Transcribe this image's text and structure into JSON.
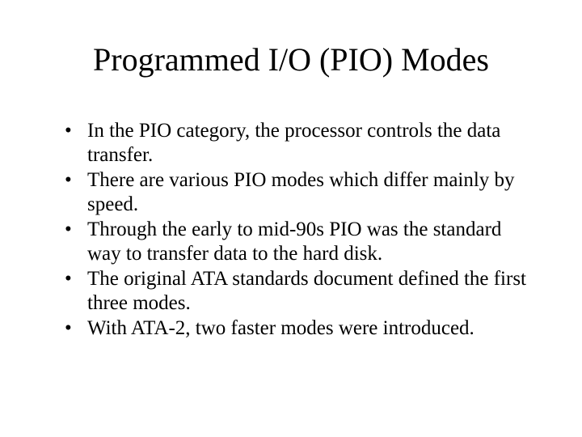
{
  "slide": {
    "title": "Programmed I/O (PIO) Modes",
    "bullets": [
      "In the PIO category, the processor controls the data transfer.",
      "There are various PIO modes which differ mainly by speed.",
      "Through the early to mid-90s PIO was the standard way to transfer data to the hard disk.",
      "The original ATA standards document defined the first three modes.",
      "With ATA-2, two faster modes were introduced."
    ]
  }
}
